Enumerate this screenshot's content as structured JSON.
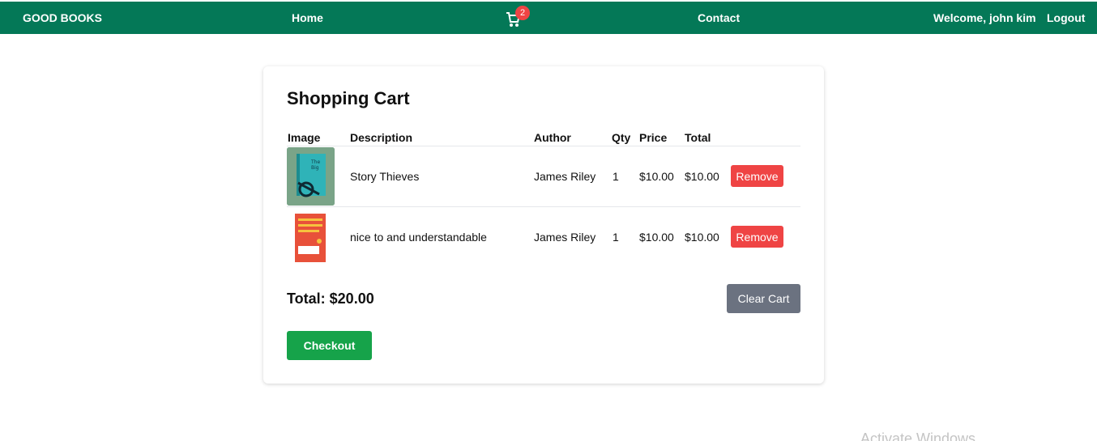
{
  "nav": {
    "brand": "GOOD BOOKS",
    "home": "Home",
    "cart_count": "2",
    "contact": "Contact",
    "welcome": "Welcome, john kim",
    "logout": "Logout"
  },
  "cart": {
    "title": "Shopping Cart",
    "headers": [
      "Image",
      "Description",
      "Author",
      "Qty",
      "Price",
      "Total"
    ],
    "rows": [
      {
        "description": "Story Thieves",
        "author": "James Riley",
        "qty": "1",
        "price": "$10.00",
        "total": "$10.00",
        "remove": "Remove"
      },
      {
        "description": "nice to and understandable",
        "author": "James Riley",
        "qty": "1",
        "price": "$10.00",
        "total": "$10.00",
        "remove": "Remove"
      }
    ],
    "total_label": "Total: $20.00",
    "clear_label": "Clear Cart",
    "checkout_label": "Checkout"
  },
  "watermark": "Activate Windows",
  "colors": {
    "nav_bg": "#047857",
    "remove": "#ef4444",
    "clear": "#6b7280",
    "checkout": "#16a34a"
  }
}
